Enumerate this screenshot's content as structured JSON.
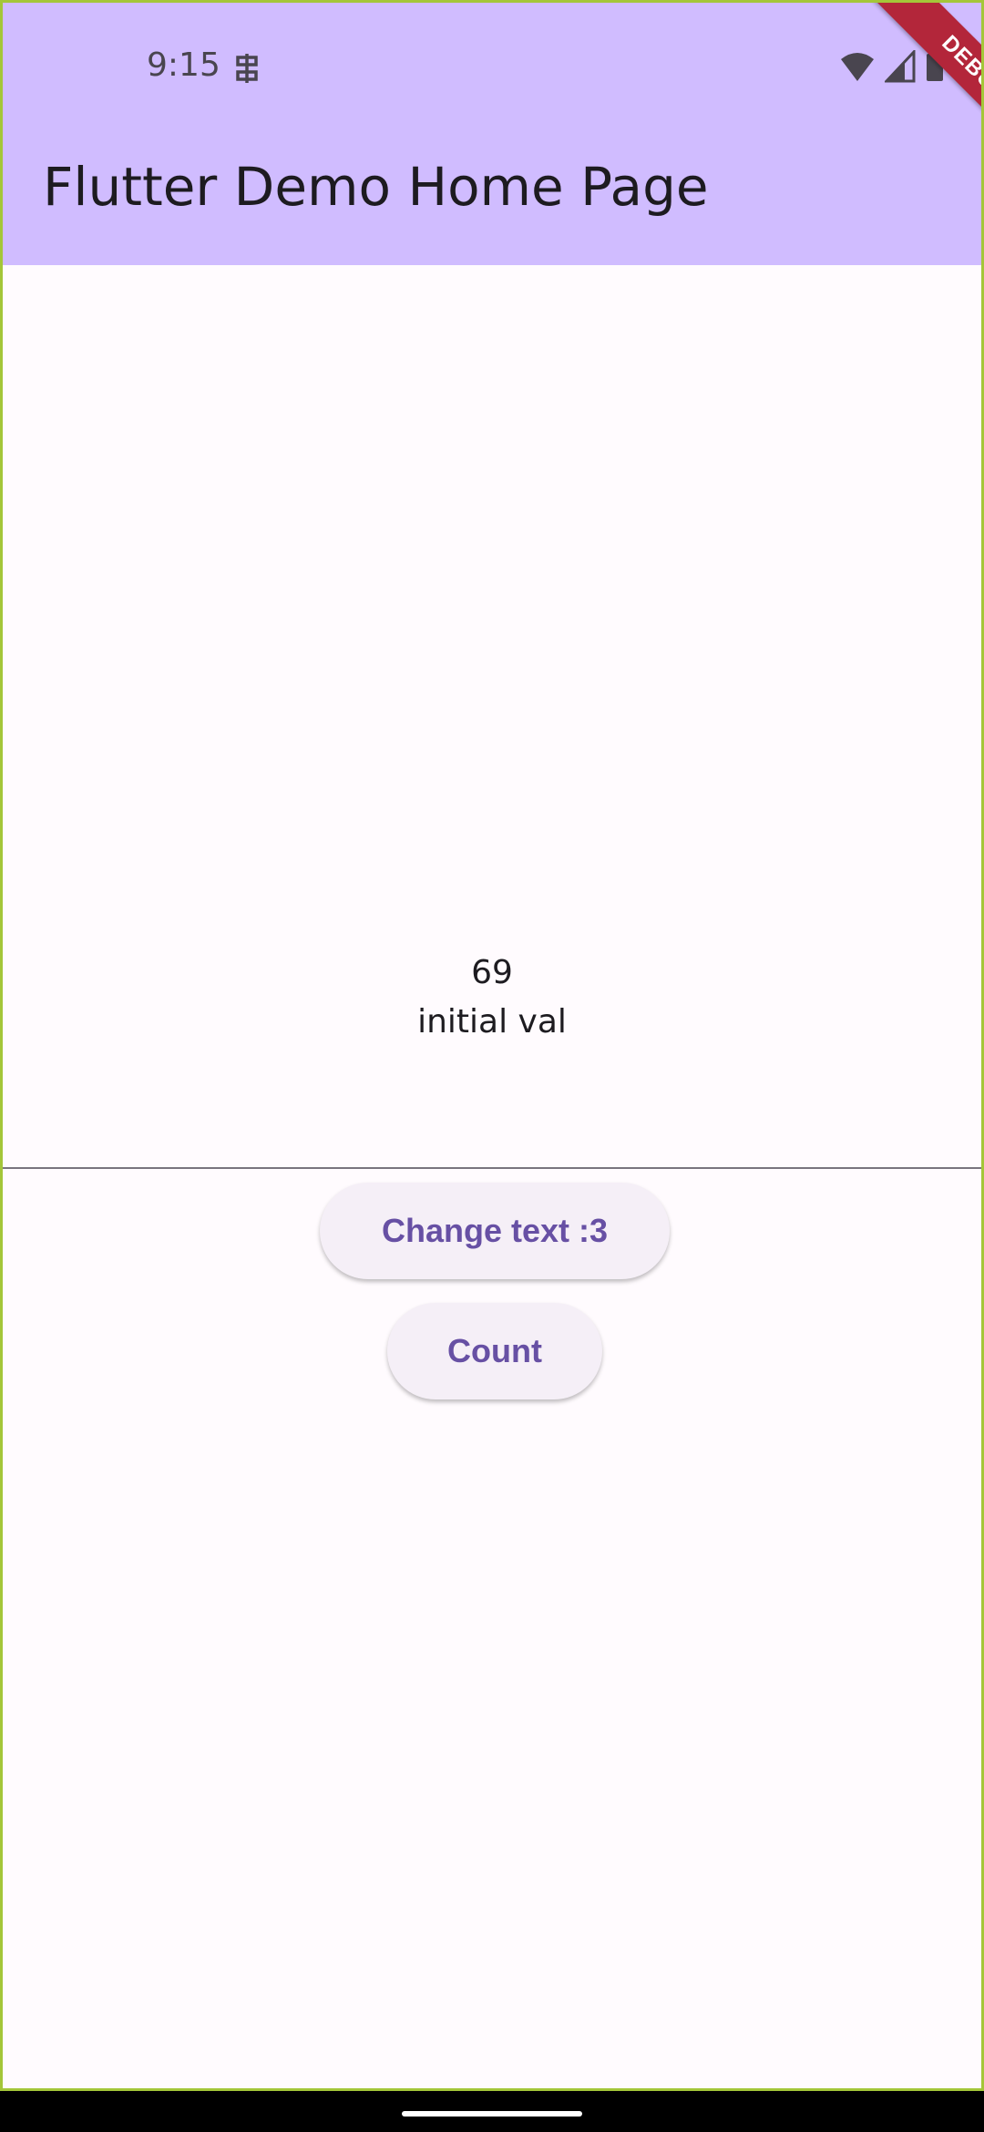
{
  "status_bar": {
    "time": "9:15"
  },
  "app_bar": {
    "title": "Flutter Demo Home Page",
    "debug_banner": "DEBUG"
  },
  "content": {
    "counter_value": "69",
    "text_value": "initial val"
  },
  "buttons": {
    "change_text_label": "Change text :3",
    "count_label": "Count"
  },
  "colors": {
    "appbar": "#d0bcff",
    "primary": "#6750a4",
    "button_bg": "#f5eff7",
    "debug": "#b3263a"
  }
}
